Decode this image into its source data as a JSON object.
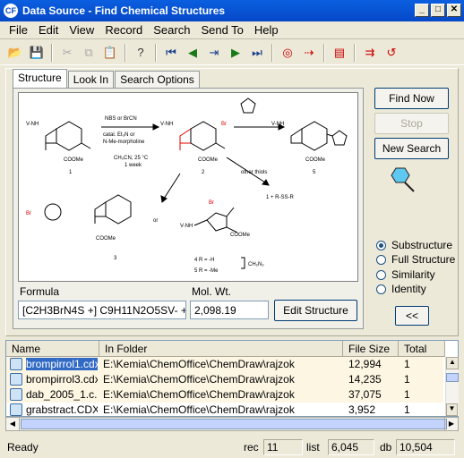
{
  "window": {
    "title": "Data Source - Find Chemical Structures",
    "app_icon": "chemfinder-icon"
  },
  "menu": [
    "File",
    "Edit",
    "View",
    "Record",
    "Search",
    "Send To",
    "Help"
  ],
  "tabs": [
    "Structure",
    "Look In",
    "Search Options"
  ],
  "scheme": {
    "reagent1": "NBS or BrCN",
    "reagent2": "catal. Et₃N or",
    "reagent3": "N-Me-morpholine",
    "cond1": "CH₃CN, 25 °C",
    "cond2": "1 week",
    "other": "other thiols",
    "c1": "1",
    "c2": "2",
    "c3": "3",
    "c5": "5",
    "or": "or",
    "prod": "1  +   R-SS-R",
    "r4": "4 R = -H",
    "r5": "5 R = -Me",
    "ch2n2": "CH₂N₂",
    "coome": "COOMe",
    "vnh": "V-NH",
    "br": "Br",
    "o": "O",
    "s": "S",
    "n": "N",
    "nh": "N",
    "h": "H"
  },
  "formula": {
    "label": "Formula",
    "value": "[C2H3BrN4S +]  C9H11N2O5SV- +  +"
  },
  "molwt": {
    "label": "Mol. Wt.",
    "value": "2,098.19"
  },
  "buttons": {
    "edit": "Edit Structure",
    "find": "Find Now",
    "stop": "Stop",
    "new": "New Search",
    "collapse": "<<"
  },
  "search_types": [
    {
      "label": "Substructure",
      "selected": true
    },
    {
      "label": "Full Structure",
      "selected": false
    },
    {
      "label": "Similarity",
      "selected": false
    },
    {
      "label": "Identity",
      "selected": false
    }
  ],
  "list": {
    "headers": [
      "Name",
      "In Folder",
      "File Size",
      "Total"
    ],
    "rows": [
      {
        "name": "brompirrol1.cdx",
        "folder": "E:\\Kemia\\ChemOffice\\ChemDraw\\rajzok",
        "size": "12,994",
        "total": "1"
      },
      {
        "name": "brompirrol3.cdx",
        "folder": "E:\\Kemia\\ChemOffice\\ChemDraw\\rajzok",
        "size": "14,235",
        "total": "1"
      },
      {
        "name": "dab_2005_1.c...",
        "folder": "E:\\Kemia\\ChemOffice\\ChemDraw\\rajzok",
        "size": "37,075",
        "total": "1"
      },
      {
        "name": "grabstract.CDX",
        "folder": "E:\\Kemia\\ChemOffice\\ChemDraw\\rajzok",
        "size": "3,952",
        "total": "1"
      }
    ]
  },
  "status": {
    "ready": "Ready",
    "rec_label": "rec",
    "rec": "11",
    "list_label": "list",
    "list": "6,045",
    "db_label": "db",
    "db": "10,504"
  },
  "colors": {
    "title_bar": "#0648c8",
    "highlight": "#ff0000",
    "query_cyan": "#00bfff"
  }
}
